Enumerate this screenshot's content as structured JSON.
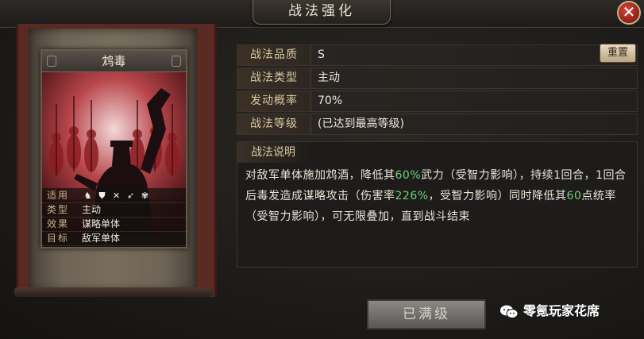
{
  "window": {
    "title": "战法强化",
    "close_label": "✕"
  },
  "card": {
    "name": "鸩毒",
    "props": [
      {
        "key": "适用",
        "value": ""
      },
      {
        "key": "类型",
        "value": "主动"
      },
      {
        "key": "效果",
        "value": "谋略单体"
      },
      {
        "key": "目标",
        "value": "敌军单体"
      }
    ],
    "unit_icons": [
      "cavalry-icon",
      "shield-icon",
      "bow-icon",
      "spear-icon",
      "siege-icon"
    ]
  },
  "info": {
    "rows": [
      {
        "key": "战法品质",
        "value": "S"
      },
      {
        "key": "战法类型",
        "value": "主动"
      },
      {
        "key": "发动概率",
        "value": "70%"
      },
      {
        "key": "战法等级",
        "value": "(已达到最高等级)"
      }
    ],
    "reset_label": "重置"
  },
  "description": {
    "title": "战法说明",
    "parts": [
      "对敌军单体施加鸩酒，降低其",
      "60%",
      "武力（受智力影响），持续1回合，1回合后毒发造成谋略攻击（伤害率",
      "226%",
      "，受智力影响）同时降低其",
      "60",
      "点统率（受智力影响），可无限叠加，直到战斗结束"
    ]
  },
  "buttons": {
    "max_level": "已满级"
  },
  "watermark": {
    "text": "零氪玩家花席"
  },
  "colors": {
    "highlight": "#6fd07a",
    "accent": "#c9b28a",
    "close": "#c0342b"
  }
}
